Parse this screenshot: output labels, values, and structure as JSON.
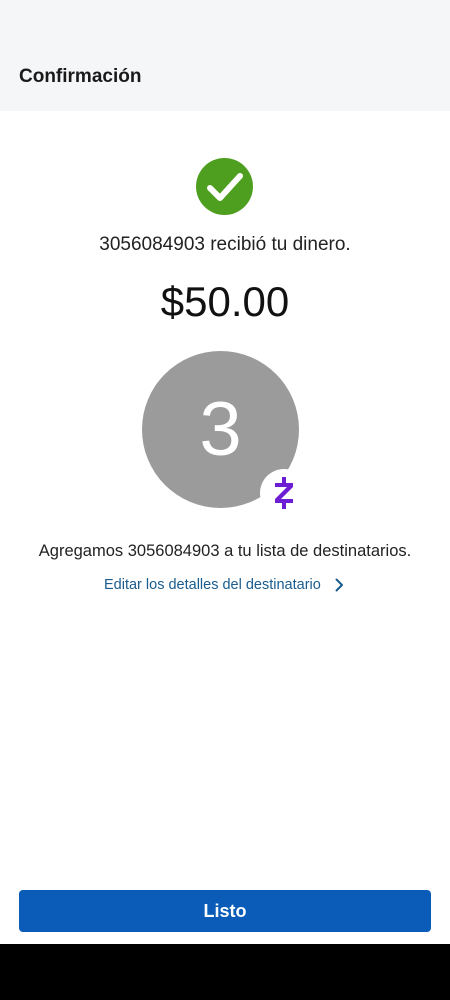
{
  "header": {
    "title": "Confirmación"
  },
  "confirmation": {
    "message": "3056084903 recibió tu dinero.",
    "amount": "$50.00"
  },
  "recipient": {
    "avatar_initial": "3",
    "badge_icon": "zelle-icon",
    "added_message": "Agregamos 3056084903 a tu lista de destinatarios.",
    "edit_link_label": "Editar los detalles del destinatario"
  },
  "actions": {
    "done_label": "Listo"
  },
  "colors": {
    "success": "#4e9f1f",
    "primary_button": "#0a5cb8",
    "link": "#1a5c8e",
    "zelle": "#6d1ed4",
    "avatar": "#9b9b9b"
  }
}
